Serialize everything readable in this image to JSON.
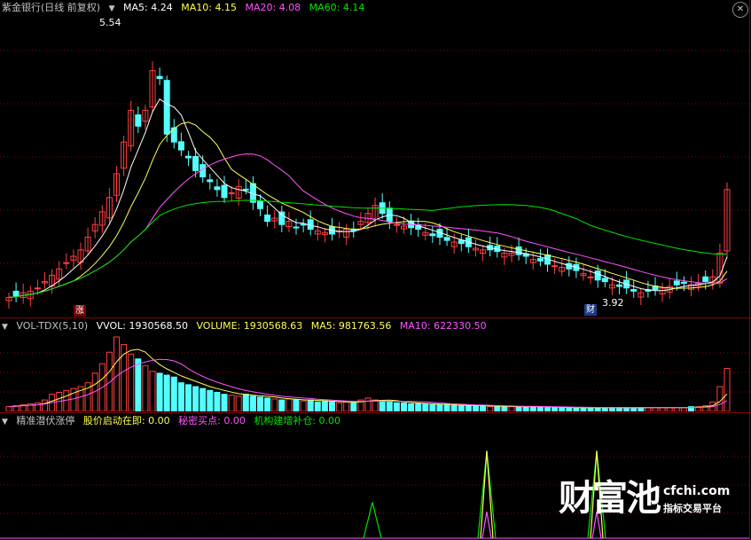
{
  "price_panel": {
    "title": "紫金银行(日线 前复权)",
    "ma5": "MA5: 4.24",
    "ma10": "MA10: 4.15",
    "ma20": "MA20: 4.08",
    "ma60": "MA60: 4.14",
    "high_label": "5.54",
    "low_label": "3.92",
    "zhang_badge": "涨",
    "cai_badge": "财"
  },
  "volume_panel": {
    "name": "VOL-TDX(5,10)",
    "vvol": "VVOL: 1930568.50",
    "volume": "VOLUME: 1930568.63",
    "ma5": "MA5: 981763.56",
    "ma10": "MA10: 622330.50"
  },
  "indicator_panel": {
    "name": "精准潜伏涨停",
    "line1": "股价启动在即: 0.00",
    "line2": "秘密买点: 0.00",
    "line3": "机构建增补仓: 0.00"
  },
  "watermark": {
    "logo": "财富池",
    "site": "cfchi.com",
    "sub": "指标交易平台"
  },
  "colors": {
    "up": "#ff4040",
    "down": "#54ffff",
    "ma5": "#ffffff",
    "ma10": "#ffff54",
    "ma20": "#ff54ff",
    "ma60": "#00e400",
    "grid": "#8b0000"
  },
  "chart_data": [
    {
      "type": "candlestick",
      "title": "紫金银行(日线 前复权)",
      "ylim": [
        3.8,
        5.7
      ],
      "annotations": [
        {
          "label": "5.54",
          "y": 5.54
        },
        {
          "label": "3.92",
          "y": 3.92
        }
      ],
      "series_close": [
        3.92,
        3.93,
        3.95,
        3.96,
        3.98,
        4.02,
        4.06,
        4.1,
        4.14,
        4.18,
        4.22,
        4.3,
        4.38,
        4.46,
        4.55,
        4.7,
        4.9,
        5.1,
        5.0,
        5.1,
        5.35,
        5.3,
        4.95,
        4.9,
        4.85,
        4.8,
        4.72,
        4.68,
        4.65,
        4.6,
        4.55,
        4.58,
        4.62,
        4.6,
        4.52,
        4.48,
        4.4,
        4.42,
        4.38,
        4.4,
        4.36,
        4.38,
        4.35,
        4.34,
        4.33,
        4.32,
        4.34,
        4.35,
        4.34,
        4.4,
        4.45,
        4.5,
        4.45,
        4.4,
        4.38,
        4.37,
        4.36,
        4.35,
        4.33,
        4.31,
        4.3,
        4.28,
        4.27,
        4.26,
        4.24,
        4.23,
        4.22,
        4.22,
        4.21,
        4.2,
        4.2,
        4.19,
        4.18,
        4.16,
        4.15,
        4.13,
        4.12,
        4.11,
        4.1,
        4.09,
        4.07,
        4.05,
        4.03,
        4.02,
        4.0,
        3.99,
        3.98,
        3.96,
        3.95,
        3.96,
        3.97,
        3.98,
        3.99,
        4.0,
        4.01,
        4.0,
        4.01,
        4.02,
        4.05,
        4.2,
        4.6
      ]
    },
    {
      "type": "bar",
      "title": "VOL-TDX(5,10)",
      "values": [
        5,
        6,
        7,
        8,
        9,
        12,
        18,
        20,
        22,
        24,
        26,
        30,
        40,
        50,
        62,
        78,
        70,
        60,
        55,
        48,
        42,
        40,
        38,
        36,
        30,
        28,
        26,
        24,
        22,
        20,
        18,
        17,
        16,
        18,
        16,
        15,
        14,
        13,
        12,
        13,
        12,
        11,
        12,
        10,
        11,
        10,
        9,
        10,
        9,
        12,
        14,
        12,
        11,
        10,
        9,
        9,
        8,
        8,
        8,
        7,
        7,
        7,
        6,
        6,
        6,
        6,
        6,
        5,
        5,
        5,
        5,
        5,
        5,
        5,
        5,
        4,
        4,
        4,
        4,
        4,
        4,
        4,
        4,
        4,
        4,
        4,
        4,
        4,
        4,
        4,
        4,
        4,
        4,
        4,
        4,
        5,
        5,
        6,
        10,
        26,
        45
      ]
    },
    {
      "type": "line",
      "title": "精准潜伏涨停",
      "spikes": [
        {
          "x": 420,
          "height": 0.35
        },
        {
          "x": 549,
          "height": 0.85
        },
        {
          "x": 673,
          "height": 0.85
        }
      ]
    }
  ]
}
